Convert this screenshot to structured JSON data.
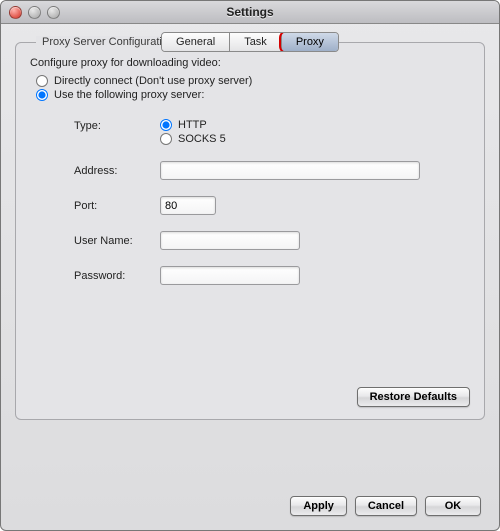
{
  "window": {
    "title": "Settings"
  },
  "tabs": {
    "general": "General",
    "task": "Task",
    "proxy": "Proxy",
    "active": "proxy"
  },
  "group": {
    "legend": "Proxy Server Configuration",
    "intro": "Configure proxy for downloading video:",
    "opt_direct": "Directly connect (Don't use proxy server)",
    "opt_use": "Use the following proxy server:"
  },
  "form": {
    "type_label": "Type:",
    "type_http": "HTTP",
    "type_socks5": "SOCKS 5",
    "address_label": "Address:",
    "address_value": "",
    "port_label": "Port:",
    "port_value": "80",
    "user_label": "User Name:",
    "user_value": "",
    "pass_label": "Password:",
    "pass_value": ""
  },
  "buttons": {
    "restore": "Restore Defaults",
    "apply": "Apply",
    "cancel": "Cancel",
    "ok": "OK"
  }
}
